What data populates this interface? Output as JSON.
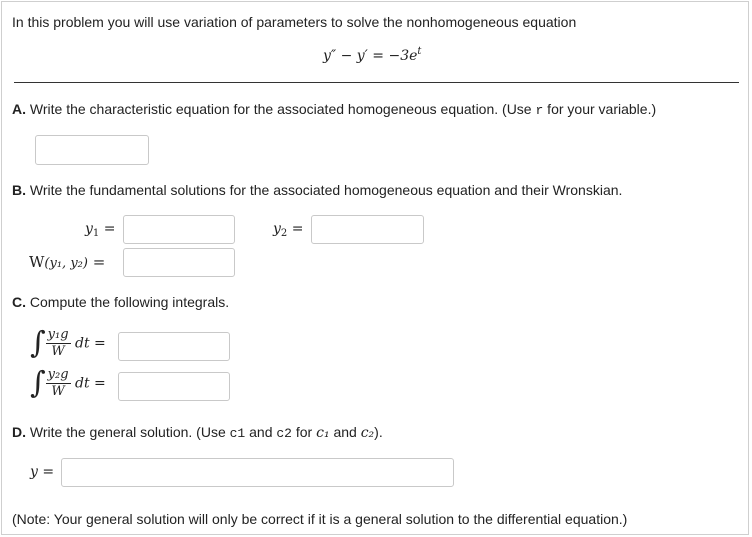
{
  "intro": "In this problem you will use variation of parameters to solve the nonhomogeneous equation",
  "equation": "y″ − y′ = −3e",
  "equation_sup": "t",
  "partA": {
    "label": "A.",
    "text_before": "Write the characteristic equation for the associated homogeneous equation. (Use ",
    "var": "r",
    "text_after": " for your variable.)",
    "answer": ""
  },
  "partB": {
    "label": "B.",
    "text": "Write the fundamental solutions for the associated homogeneous equation and their Wronskian.",
    "y1_label": "y",
    "y1_sub": "1",
    "y2_label": "y",
    "y2_sub": "2",
    "wronskian_label": "W",
    "wronskian_args": "(y₁, y₂)",
    "eq": "=",
    "y1_answer": "",
    "y2_answer": "",
    "w_answer": ""
  },
  "partC": {
    "label": "C.",
    "text": "Compute the following integrals.",
    "int1_num": "y₁g",
    "int2_num": "y₂g",
    "den": "W",
    "dt": "dt",
    "eq": "=",
    "int1_answer": "",
    "int2_answer": ""
  },
  "partD": {
    "label": "D.",
    "text_1": "Write the general solution. (Use ",
    "c1": "c1",
    "text_2": " and ",
    "c2": "c2",
    "text_3": " for ",
    "c1_math": "c₁",
    "text_4": " and ",
    "c2_math": "c₂",
    "text_5": ").",
    "y_label": "y",
    "eq": "=",
    "answer": ""
  },
  "note": "(Note: Your general solution will only be correct if it is a general solution to the differential equation.)"
}
